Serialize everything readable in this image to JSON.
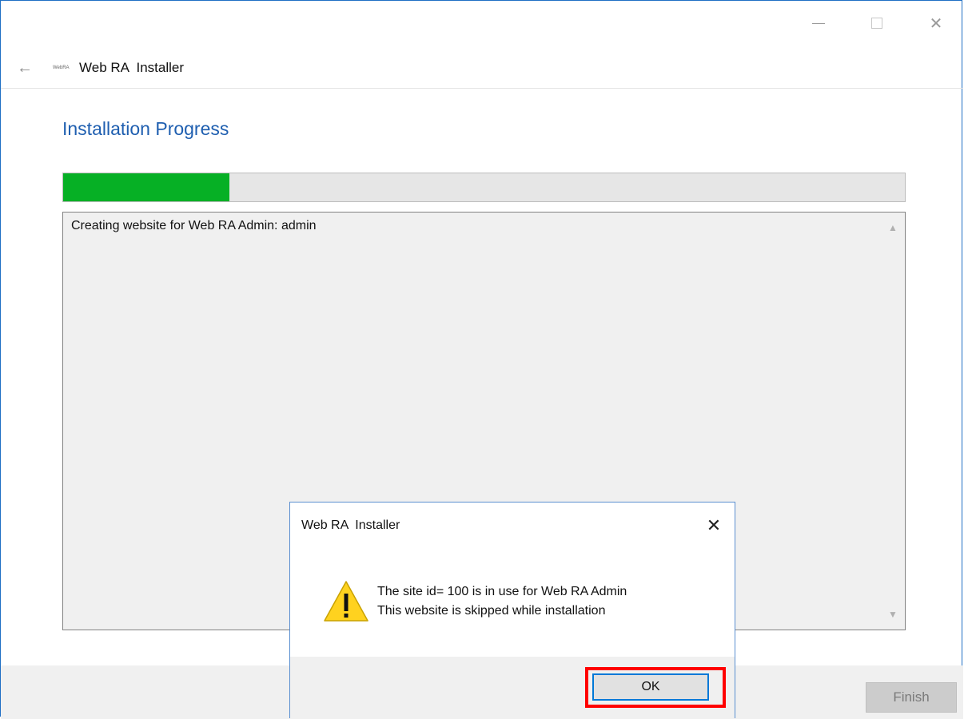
{
  "window": {
    "title": "Web RA  Installer",
    "logo_text": "WebRA",
    "minimize_symbol": "—",
    "close_symbol": "✕",
    "back_symbol": "←"
  },
  "page": {
    "heading": "Installation Progress",
    "progress_fraction": 0.198,
    "progress_color": "#06b025",
    "log_text": "Creating website for Web RA Admin: admin",
    "scroll_up_symbol": "▲",
    "scroll_down_symbol": "▼"
  },
  "footer": {
    "finish_label": "Finish"
  },
  "dialog": {
    "title": "Web RA  Installer",
    "close_symbol": "✕",
    "icon": "warning-icon",
    "message_line1": "The site id= 100 is in use for Web RA Admin",
    "message_line2": "This website is skipped while installation",
    "ok_label": "OK",
    "highlight_color": "#ff0000"
  }
}
